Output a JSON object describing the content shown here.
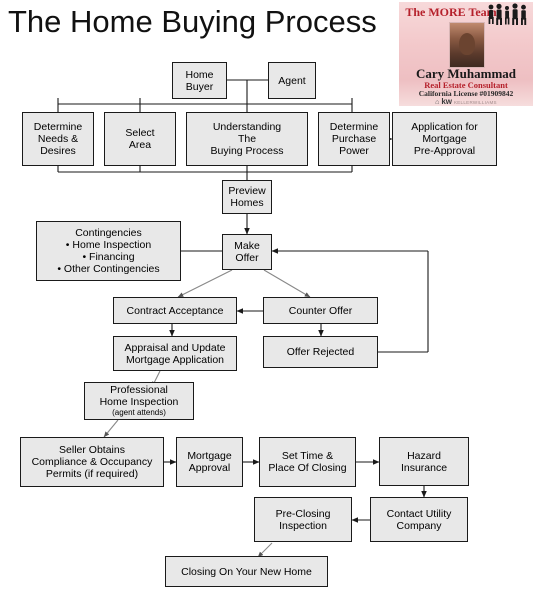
{
  "page": {
    "title": "The Home Buying Process"
  },
  "logo": {
    "team_name": "The MORE Team",
    "agent_name": "Cary Muhammad",
    "agent_role": "Real Estate Consultant",
    "license": "California License #01909842",
    "brand": "kw",
    "brand_sub": "KELLERWILLIAMS",
    "icon_people": "people-group-icon",
    "icon_photo": "agent-photo",
    "bg_color": "#f3c9cb",
    "accent_color": "#b5202b"
  },
  "flowchart": {
    "type": "flowchart",
    "nodes": [
      {
        "id": "home-buyer",
        "label": "Home\nBuyer"
      },
      {
        "id": "agent",
        "label": "Agent"
      },
      {
        "id": "determine-needs",
        "label": "Determine\nNeeds &\nDesires"
      },
      {
        "id": "select-area",
        "label": "Select\nArea"
      },
      {
        "id": "understanding-process",
        "label": "Understanding\nThe\nBuying Process"
      },
      {
        "id": "determine-power",
        "label": "Determine\nPurchase\nPower"
      },
      {
        "id": "mortgage-preapproval",
        "label": "Application for\nMortgage\nPre-Approval"
      },
      {
        "id": "preview-homes",
        "label": "Preview\nHomes"
      },
      {
        "id": "contingencies",
        "label": "Contingencies\n• Home Inspection\n• Financing\n• Other Contingencies"
      },
      {
        "id": "make-offer",
        "label": "Make\nOffer"
      },
      {
        "id": "contract-acceptance",
        "label": "Contract Acceptance"
      },
      {
        "id": "counter-offer",
        "label": "Counter Offer"
      },
      {
        "id": "appraisal-update",
        "label": "Appraisal and Update\nMortgage Application"
      },
      {
        "id": "offer-rejected",
        "label": "Offer Rejected"
      },
      {
        "id": "professional-inspection",
        "label": "Professional\nHome Inspection",
        "sublabel": "(agent attends)"
      },
      {
        "id": "seller-obtains",
        "label": "Seller Obtains\nCompliance & Occupancy\nPermits (if required)"
      },
      {
        "id": "mortgage-approval",
        "label": "Mortgage\nApproval"
      },
      {
        "id": "set-time-place",
        "label": "Set Time &\nPlace Of Closing"
      },
      {
        "id": "hazard-insurance",
        "label": "Hazard\nInsurance"
      },
      {
        "id": "pre-closing-inspection",
        "label": "Pre-Closing\nInspection"
      },
      {
        "id": "contact-utility",
        "label": "Contact Utility\nCompany"
      },
      {
        "id": "closing",
        "label": "Closing On Your New Home"
      }
    ],
    "edges": [
      {
        "from": "home-buyer",
        "to": "agent",
        "style": "plain"
      },
      {
        "from": "home-buyer",
        "to": "determine-needs",
        "style": "plain"
      },
      {
        "from": "home-buyer",
        "to": "select-area",
        "style": "plain"
      },
      {
        "from": "home-buyer",
        "to": "understanding-process",
        "style": "plain"
      },
      {
        "from": "home-buyer",
        "to": "determine-power",
        "style": "plain"
      },
      {
        "from": "determine-power",
        "to": "mortgage-preapproval",
        "style": "double-arrow"
      },
      {
        "from": "understanding-process",
        "to": "preview-homes",
        "style": "plain"
      },
      {
        "from": "preview-homes",
        "to": "make-offer",
        "style": "arrow"
      },
      {
        "from": "contingencies",
        "to": "make-offer",
        "style": "plain"
      },
      {
        "from": "make-offer",
        "to": "contract-acceptance",
        "style": "arrow"
      },
      {
        "from": "make-offer",
        "to": "counter-offer",
        "style": "arrow"
      },
      {
        "from": "counter-offer",
        "to": "contract-acceptance",
        "style": "arrow"
      },
      {
        "from": "counter-offer",
        "to": "offer-rejected",
        "style": "arrow"
      },
      {
        "from": "offer-rejected",
        "to": "make-offer",
        "style": "arrow"
      },
      {
        "from": "contract-acceptance",
        "to": "appraisal-update",
        "style": "arrow"
      },
      {
        "from": "appraisal-update",
        "to": "professional-inspection",
        "style": "arrow"
      },
      {
        "from": "professional-inspection",
        "to": "seller-obtains",
        "style": "arrow"
      },
      {
        "from": "seller-obtains",
        "to": "mortgage-approval",
        "style": "arrow"
      },
      {
        "from": "mortgage-approval",
        "to": "set-time-place",
        "style": "arrow"
      },
      {
        "from": "set-time-place",
        "to": "hazard-insurance",
        "style": "arrow"
      },
      {
        "from": "hazard-insurance",
        "to": "contact-utility",
        "style": "arrow"
      },
      {
        "from": "contact-utility",
        "to": "pre-closing-inspection",
        "style": "arrow"
      },
      {
        "from": "pre-closing-inspection",
        "to": "closing",
        "style": "arrow"
      }
    ],
    "box_fill": "#e8e8e8",
    "box_border": "#1a1a1a"
  }
}
